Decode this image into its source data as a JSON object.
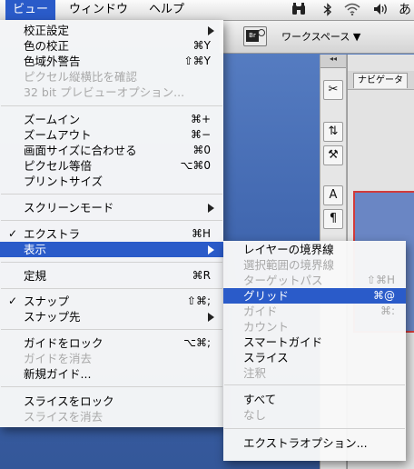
{
  "menubar": {
    "menus": [
      "ビュー",
      "ウィンドウ",
      "ヘルプ"
    ],
    "icons": [
      "binoculars-icon",
      "bluetooth-icon",
      "wifi-icon",
      "volume-icon",
      "input-method-icon"
    ],
    "input_method_glyph": "あ"
  },
  "app": {
    "workspace_label": "ワークスペース ▼",
    "navigator_tab": "ナビゲータ",
    "toolbox_header": "◂◂",
    "doc_button_text": "Br"
  },
  "view_menu": {
    "items": [
      {
        "label": "校正設定",
        "shortcut": "",
        "submenu": true
      },
      {
        "label": "色の校正",
        "shortcut": "⌘Y"
      },
      {
        "label": "色域外警告",
        "shortcut": "⇧⌘Y"
      },
      {
        "label": "ピクセル縦横比を確認",
        "shortcut": "",
        "disabled": true
      },
      {
        "label": "32 bit プレビューオプション...",
        "shortcut": "",
        "disabled": true
      },
      {
        "label": "ズームイン",
        "shortcut": "⌘+"
      },
      {
        "label": "ズームアウト",
        "shortcut": "⌘−"
      },
      {
        "label": "画面サイズに合わせる",
        "shortcut": "⌘0"
      },
      {
        "label": "ピクセル等倍",
        "shortcut": "⌥⌘0"
      },
      {
        "label": "プリントサイズ",
        "shortcut": ""
      },
      {
        "label": "スクリーンモード",
        "shortcut": "",
        "submenu": true
      },
      {
        "label": "エクストラ",
        "shortcut": "⌘H",
        "checked": true
      },
      {
        "label": "表示",
        "shortcut": "",
        "submenu": true,
        "highlighted": true
      },
      {
        "label": "定規",
        "shortcut": "⌘R"
      },
      {
        "label": "スナップ",
        "shortcut": "⇧⌘;",
        "checked": true
      },
      {
        "label": "スナップ先",
        "shortcut": "",
        "submenu": true
      },
      {
        "label": "ガイドをロック",
        "shortcut": "⌥⌘;"
      },
      {
        "label": "ガイドを消去",
        "shortcut": "",
        "disabled": true
      },
      {
        "label": "新規ガイド...",
        "shortcut": ""
      },
      {
        "label": "スライスをロック",
        "shortcut": ""
      },
      {
        "label": "スライスを消去",
        "shortcut": "",
        "disabled": true
      }
    ]
  },
  "show_submenu": {
    "items": [
      {
        "label": "レイヤーの境界線",
        "shortcut": ""
      },
      {
        "label": "選択範囲の境界線",
        "shortcut": "",
        "disabled": true
      },
      {
        "label": "ターゲットパス",
        "shortcut": "⇧⌘H",
        "disabled": true
      },
      {
        "label": "グリッド",
        "shortcut": "⌘@",
        "highlighted": true
      },
      {
        "label": "ガイド",
        "shortcut": "⌘:",
        "disabled": true
      },
      {
        "label": "カウント",
        "shortcut": "",
        "disabled": true
      },
      {
        "label": "スマートガイド",
        "shortcut": ""
      },
      {
        "label": "スライス",
        "shortcut": ""
      },
      {
        "label": "注釈",
        "shortcut": "",
        "disabled": true
      },
      {
        "label": "すべて",
        "shortcut": ""
      },
      {
        "label": "なし",
        "shortcut": "",
        "disabled": true
      },
      {
        "label": "エクストラオプション...",
        "shortcut": ""
      }
    ]
  },
  "colors": {
    "highlight": "#2a5bc9",
    "disabled_text": "#a8a8a8"
  }
}
